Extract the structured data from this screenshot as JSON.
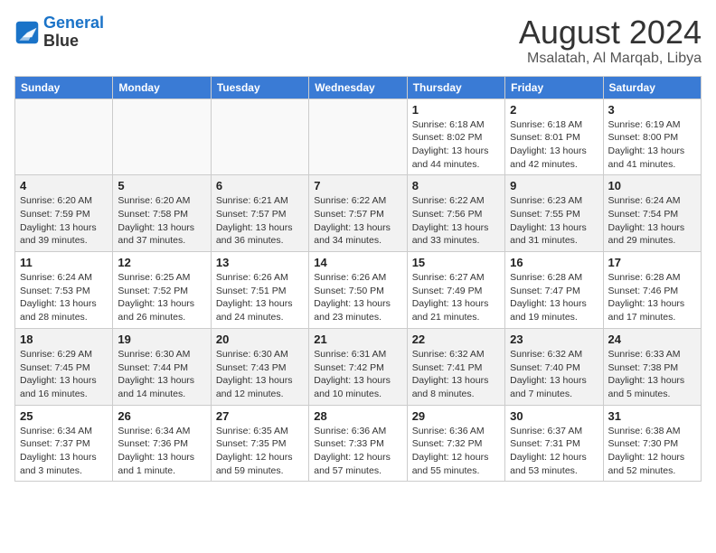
{
  "header": {
    "logo_line1": "General",
    "logo_line2": "Blue",
    "month_year": "August 2024",
    "location": "Msalatah, Al Marqab, Libya"
  },
  "weekdays": [
    "Sunday",
    "Monday",
    "Tuesday",
    "Wednesday",
    "Thursday",
    "Friday",
    "Saturday"
  ],
  "weeks": [
    [
      {
        "day": "",
        "info": ""
      },
      {
        "day": "",
        "info": ""
      },
      {
        "day": "",
        "info": ""
      },
      {
        "day": "",
        "info": ""
      },
      {
        "day": "1",
        "info": "Sunrise: 6:18 AM\nSunset: 8:02 PM\nDaylight: 13 hours\nand 44 minutes."
      },
      {
        "day": "2",
        "info": "Sunrise: 6:18 AM\nSunset: 8:01 PM\nDaylight: 13 hours\nand 42 minutes."
      },
      {
        "day": "3",
        "info": "Sunrise: 6:19 AM\nSunset: 8:00 PM\nDaylight: 13 hours\nand 41 minutes."
      }
    ],
    [
      {
        "day": "4",
        "info": "Sunrise: 6:20 AM\nSunset: 7:59 PM\nDaylight: 13 hours\nand 39 minutes."
      },
      {
        "day": "5",
        "info": "Sunrise: 6:20 AM\nSunset: 7:58 PM\nDaylight: 13 hours\nand 37 minutes."
      },
      {
        "day": "6",
        "info": "Sunrise: 6:21 AM\nSunset: 7:57 PM\nDaylight: 13 hours\nand 36 minutes."
      },
      {
        "day": "7",
        "info": "Sunrise: 6:22 AM\nSunset: 7:57 PM\nDaylight: 13 hours\nand 34 minutes."
      },
      {
        "day": "8",
        "info": "Sunrise: 6:22 AM\nSunset: 7:56 PM\nDaylight: 13 hours\nand 33 minutes."
      },
      {
        "day": "9",
        "info": "Sunrise: 6:23 AM\nSunset: 7:55 PM\nDaylight: 13 hours\nand 31 minutes."
      },
      {
        "day": "10",
        "info": "Sunrise: 6:24 AM\nSunset: 7:54 PM\nDaylight: 13 hours\nand 29 minutes."
      }
    ],
    [
      {
        "day": "11",
        "info": "Sunrise: 6:24 AM\nSunset: 7:53 PM\nDaylight: 13 hours\nand 28 minutes."
      },
      {
        "day": "12",
        "info": "Sunrise: 6:25 AM\nSunset: 7:52 PM\nDaylight: 13 hours\nand 26 minutes."
      },
      {
        "day": "13",
        "info": "Sunrise: 6:26 AM\nSunset: 7:51 PM\nDaylight: 13 hours\nand 24 minutes."
      },
      {
        "day": "14",
        "info": "Sunrise: 6:26 AM\nSunset: 7:50 PM\nDaylight: 13 hours\nand 23 minutes."
      },
      {
        "day": "15",
        "info": "Sunrise: 6:27 AM\nSunset: 7:49 PM\nDaylight: 13 hours\nand 21 minutes."
      },
      {
        "day": "16",
        "info": "Sunrise: 6:28 AM\nSunset: 7:47 PM\nDaylight: 13 hours\nand 19 minutes."
      },
      {
        "day": "17",
        "info": "Sunrise: 6:28 AM\nSunset: 7:46 PM\nDaylight: 13 hours\nand 17 minutes."
      }
    ],
    [
      {
        "day": "18",
        "info": "Sunrise: 6:29 AM\nSunset: 7:45 PM\nDaylight: 13 hours\nand 16 minutes."
      },
      {
        "day": "19",
        "info": "Sunrise: 6:30 AM\nSunset: 7:44 PM\nDaylight: 13 hours\nand 14 minutes."
      },
      {
        "day": "20",
        "info": "Sunrise: 6:30 AM\nSunset: 7:43 PM\nDaylight: 13 hours\nand 12 minutes."
      },
      {
        "day": "21",
        "info": "Sunrise: 6:31 AM\nSunset: 7:42 PM\nDaylight: 13 hours\nand 10 minutes."
      },
      {
        "day": "22",
        "info": "Sunrise: 6:32 AM\nSunset: 7:41 PM\nDaylight: 13 hours\nand 8 minutes."
      },
      {
        "day": "23",
        "info": "Sunrise: 6:32 AM\nSunset: 7:40 PM\nDaylight: 13 hours\nand 7 minutes."
      },
      {
        "day": "24",
        "info": "Sunrise: 6:33 AM\nSunset: 7:38 PM\nDaylight: 13 hours\nand 5 minutes."
      }
    ],
    [
      {
        "day": "25",
        "info": "Sunrise: 6:34 AM\nSunset: 7:37 PM\nDaylight: 13 hours\nand 3 minutes."
      },
      {
        "day": "26",
        "info": "Sunrise: 6:34 AM\nSunset: 7:36 PM\nDaylight: 13 hours\nand 1 minute."
      },
      {
        "day": "27",
        "info": "Sunrise: 6:35 AM\nSunset: 7:35 PM\nDaylight: 12 hours\nand 59 minutes."
      },
      {
        "day": "28",
        "info": "Sunrise: 6:36 AM\nSunset: 7:33 PM\nDaylight: 12 hours\nand 57 minutes."
      },
      {
        "day": "29",
        "info": "Sunrise: 6:36 AM\nSunset: 7:32 PM\nDaylight: 12 hours\nand 55 minutes."
      },
      {
        "day": "30",
        "info": "Sunrise: 6:37 AM\nSunset: 7:31 PM\nDaylight: 12 hours\nand 53 minutes."
      },
      {
        "day": "31",
        "info": "Sunrise: 6:38 AM\nSunset: 7:30 PM\nDaylight: 12 hours\nand 52 minutes."
      }
    ]
  ]
}
